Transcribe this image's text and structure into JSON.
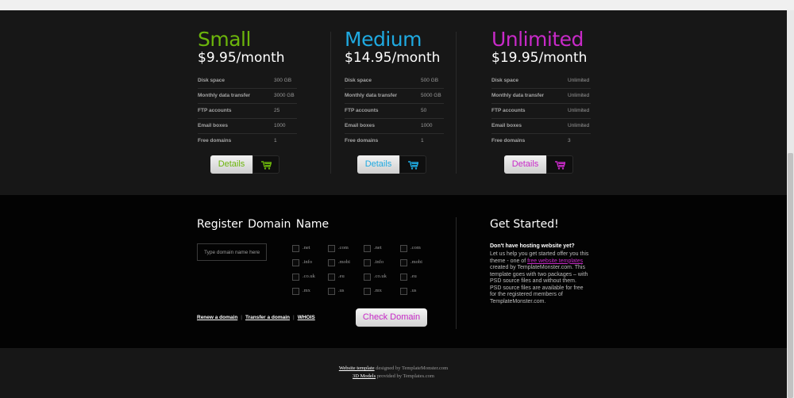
{
  "plans": [
    {
      "name": "Small",
      "price": "$9.95/month",
      "color": "#6cb50b",
      "specs": [
        {
          "label": "Disk space",
          "value": "300 GB"
        },
        {
          "label": "Monthly data transfer",
          "value": "3000 GB"
        },
        {
          "label": "FTP accounts",
          "value": "25"
        },
        {
          "label": "Email boxes",
          "value": "1000"
        },
        {
          "label": "Free domains",
          "value": "1"
        }
      ],
      "details_label": "Details",
      "cart_icon": "cart-icon"
    },
    {
      "name": "Medium",
      "price": "$14.95/month",
      "color": "#1fa9e0",
      "specs": [
        {
          "label": "Disk space",
          "value": "500 GB"
        },
        {
          "label": "Monthly data transfer",
          "value": "5000 GB"
        },
        {
          "label": "FTP accounts",
          "value": "50"
        },
        {
          "label": "Email boxes",
          "value": "1000"
        },
        {
          "label": "Free domains",
          "value": "1"
        }
      ],
      "details_label": "Details",
      "cart_icon": "cart-icon"
    },
    {
      "name": "Unlimited",
      "price": "$19.95/month",
      "color": "#c82ac8",
      "specs": [
        {
          "label": "Disk space",
          "value": "Unlimited"
        },
        {
          "label": "Monthly data transfer",
          "value": "Unlimited"
        },
        {
          "label": "FTP accounts",
          "value": "Unlimited"
        },
        {
          "label": "Email boxes",
          "value": "Unlimited"
        },
        {
          "label": "Free domains",
          "value": "3"
        }
      ],
      "details_label": "Details",
      "cart_icon": "cart-icon"
    }
  ],
  "domain": {
    "title": "Register Domain Name",
    "input_placeholder": "Type domain name here",
    "tlds": [
      [
        ".net",
        ".com",
        ".net",
        ".com"
      ],
      [
        ".info",
        ".mobi",
        ".info",
        ".mobi"
      ],
      [
        ".co.uk",
        ".eu",
        ".co.uk",
        ".eu"
      ],
      [
        ".mx",
        ".us",
        ".mx",
        ".us"
      ]
    ],
    "links": [
      "Renew a domain",
      "Transfer a domain",
      "WHOIS"
    ],
    "link_separator": "|",
    "check_label": "Check Domain"
  },
  "get_started": {
    "title": "Get Started!",
    "heading": "Don't have hosting website yet?",
    "text_before": "Let us help you get started offer you this theme - one of ",
    "link_text": "free website templates",
    "text_after": " created by TemplateMonster.com. This template goes with two packages – with PSD source files and without them. PSD source files are available for free for the registered members of TemplateMonster.com."
  },
  "footer": {
    "line1_link": "Website template",
    "line1_text": " designed by TemplateMonster.com",
    "line2_link": "3D Models",
    "line2_text": " provided by Templates.com"
  }
}
